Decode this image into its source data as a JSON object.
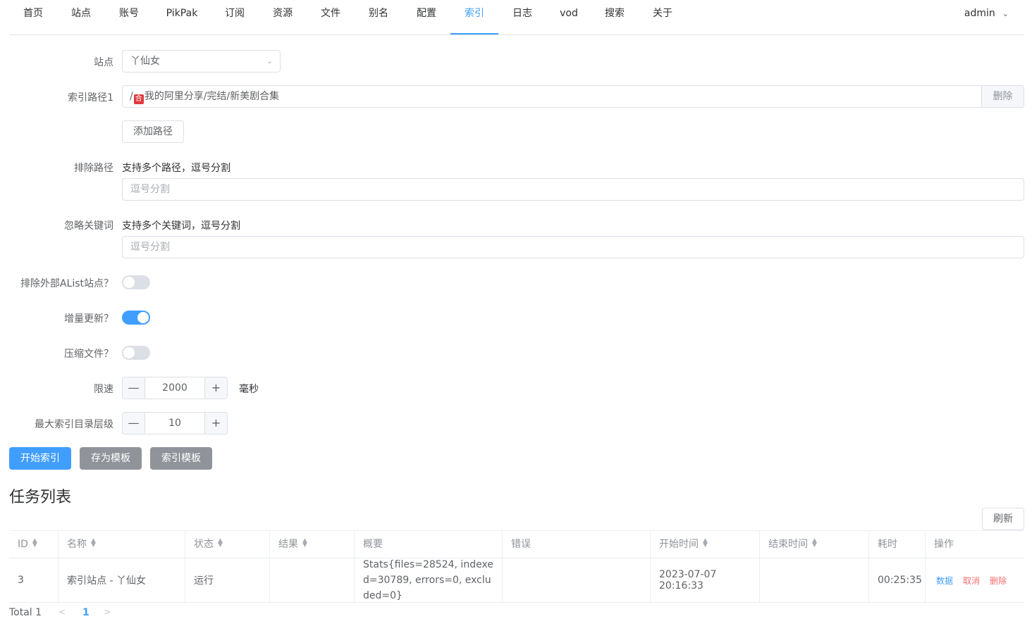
{
  "nav": {
    "items": [
      "首页",
      "站点",
      "账号",
      "PikPak",
      "订阅",
      "资源",
      "文件",
      "别名",
      "配置",
      "索引",
      "日志",
      "vod",
      "搜索",
      "关于"
    ],
    "active": "索引",
    "user": "admin"
  },
  "form": {
    "site_label": "站点",
    "site_value": "丫仙女",
    "path_label": "索引路径1",
    "path_prefix": "/",
    "path_mark": "合",
    "path_value": "我的阿里分享/完结/新美剧合集",
    "path_delete": "删除",
    "add_path": "添加路径",
    "exclude_label": "排除路径",
    "exclude_hint": "支持多个路径，逗号分割",
    "exclude_placeholder": "逗号分割",
    "ignore_label": "忽略关键词",
    "ignore_hint": "支持多个关键词，逗号分割",
    "ignore_placeholder": "逗号分割",
    "exclude_alist_label": "排除外部AList站点？",
    "exclude_alist_on": false,
    "incremental_label": "增量更新？",
    "incremental_on": true,
    "compress_label": "压缩文件？",
    "compress_on": false,
    "rate_label": "限速",
    "rate_value": "2000",
    "rate_unit": "毫秒",
    "depth_label": "最大索引目录层级",
    "depth_value": "10",
    "minus": "—",
    "plus": "+"
  },
  "actions": {
    "start": "开始索引",
    "save_template": "存为模板",
    "index_template": "索引模板"
  },
  "tasks": {
    "title": "任务列表",
    "refresh": "刷新",
    "columns": [
      "ID",
      "名称",
      "状态",
      "结果",
      "概要",
      "错误",
      "开始时间",
      "结束时间",
      "耗时",
      "操作"
    ],
    "rows": [
      {
        "id": "3",
        "name": "索引站点 - 丫仙女",
        "status": "运行",
        "result": "",
        "summary": "Stats{files=28524, indexed=30789, errors=0, excluded=0}",
        "error": "",
        "start": "2023-07-07 20:16:33",
        "end": "",
        "duration": "00:25:35",
        "ops": [
          "数据",
          "取消",
          "删除"
        ]
      }
    ],
    "total": "Total 1",
    "page": "1"
  },
  "colors": {
    "primary": "#409eff",
    "danger": "#f56c6c",
    "gray_button": "#909399"
  },
  "icons": [
    "chevron-down-icon",
    "sort-icon",
    "chevron-left-icon",
    "chevron-right-icon"
  ]
}
